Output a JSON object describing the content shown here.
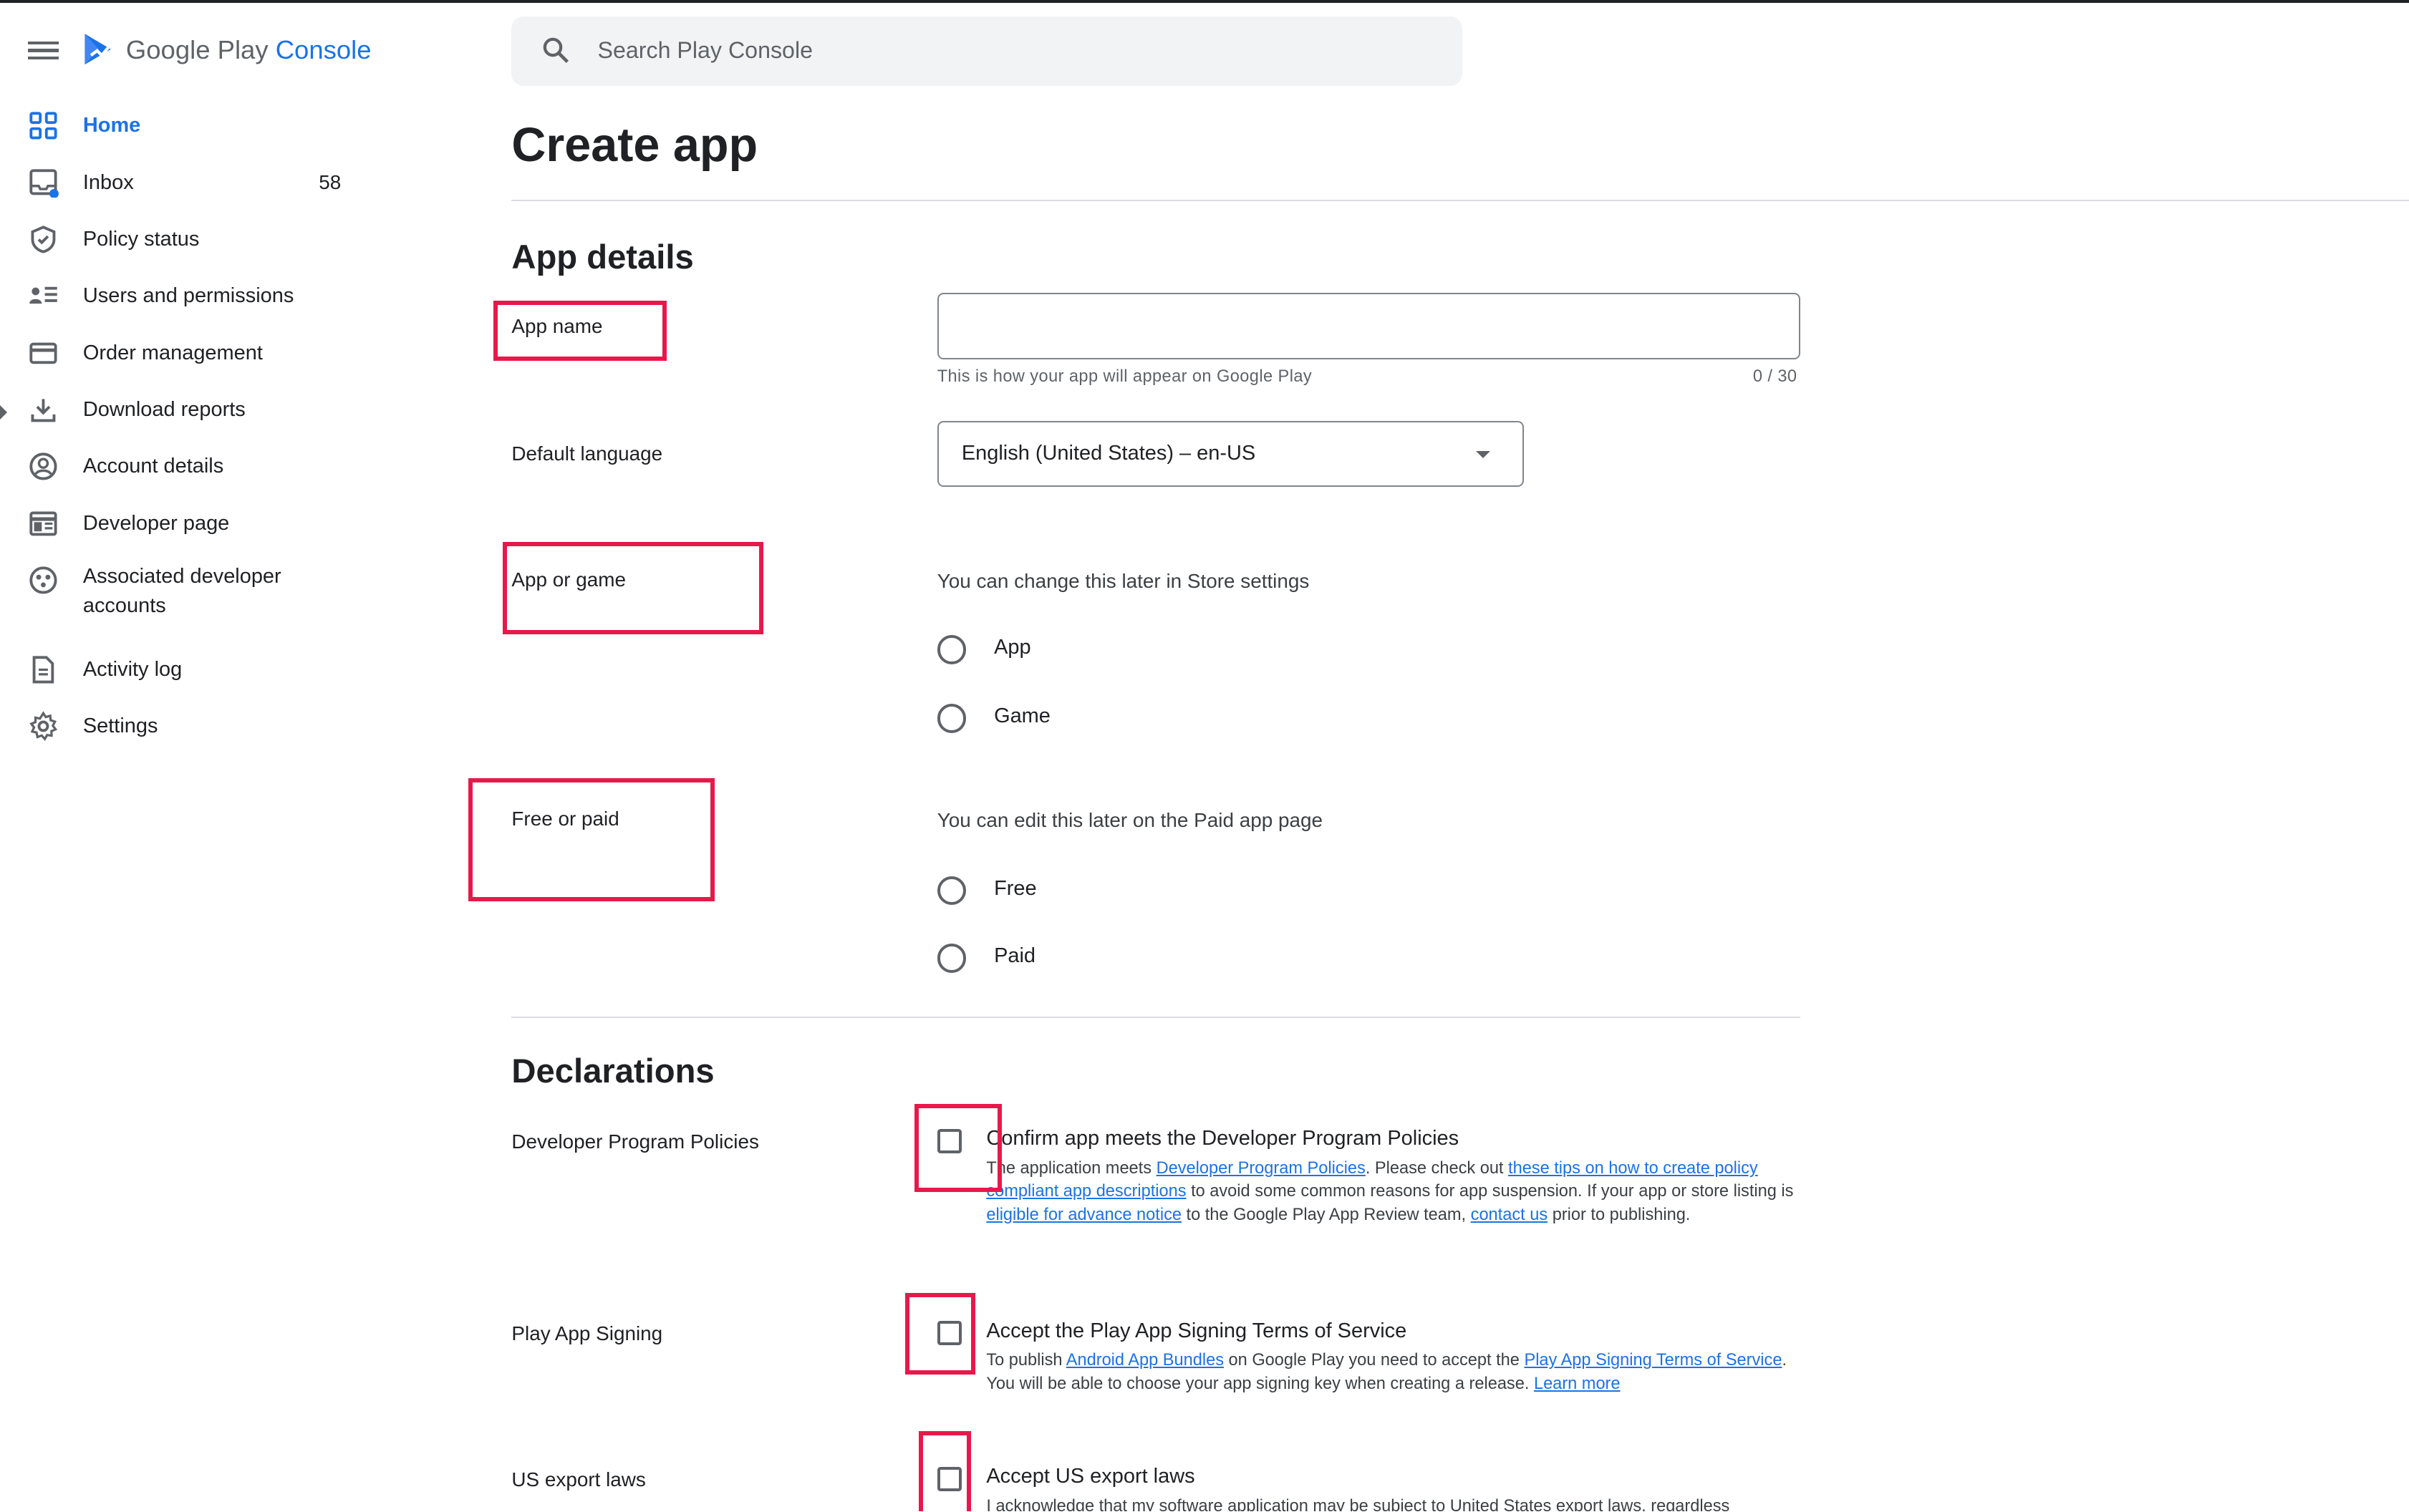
{
  "app": {
    "logo_text": "Google Play",
    "logo_accent": "Console"
  },
  "sidebar": {
    "items": [
      {
        "label": "Home",
        "icon": "home-grid-icon",
        "active": true
      },
      {
        "label": "Inbox",
        "icon": "inbox-icon",
        "count": "58"
      },
      {
        "label": "Policy status",
        "icon": "shield-icon"
      },
      {
        "label": "Users and permissions",
        "icon": "users-list-icon"
      },
      {
        "label": "Order management",
        "icon": "credit-card-icon"
      },
      {
        "label": "Download reports",
        "icon": "download-icon"
      },
      {
        "label": "Account details",
        "icon": "account-circle-icon"
      },
      {
        "label": "Developer page",
        "icon": "web-page-icon"
      },
      {
        "label": "Associated developer accounts",
        "icon": "linked-accounts-icon"
      },
      {
        "label": "Activity log",
        "icon": "document-icon"
      },
      {
        "label": "Settings",
        "icon": "gear-icon"
      }
    ]
  },
  "search": {
    "placeholder": "Search Play Console"
  },
  "page": {
    "title": "Create app"
  },
  "app_details": {
    "title": "App details",
    "app_name": {
      "label": "App name",
      "value": "",
      "helper": "This is how your app will appear on Google Play",
      "counter": "0 / 30"
    },
    "default_language": {
      "label": "Default language",
      "value": "English (United States) – en-US"
    },
    "app_or_game": {
      "label": "App or game",
      "hint": "You can change this later in Store settings",
      "options": [
        "App",
        "Game"
      ]
    },
    "free_or_paid": {
      "label": "Free or paid",
      "hint": "You can edit this later on the Paid app page",
      "options": [
        "Free",
        "Paid"
      ]
    }
  },
  "declarations": {
    "title": "Declarations",
    "policies": {
      "label": "Developer Program Policies",
      "checkbox_title": "Confirm app meets the Developer Program Policies",
      "body": {
        "t1": "The application meets ",
        "l1": "Developer Program Policies",
        "t2": ". Please check out ",
        "l2": "these tips on how to create policy compliant app descriptions",
        "t3": " to avoid some common reasons for app suspension. If your app or store listing is ",
        "l3": "eligible for advance notice",
        "t4": " to the Google Play App Review team, ",
        "l4": "contact us",
        "t5": " prior to publishing."
      }
    },
    "signing": {
      "label": "Play App Signing",
      "checkbox_title": "Accept the Play App Signing Terms of Service",
      "body": {
        "t1": "To publish ",
        "l1": "Android App Bundles",
        "t2": " on Google Play you need to accept the ",
        "l2": "Play App Signing Terms of Service",
        "t3": ". You will be able to choose your app signing key when creating a release. ",
        "l3": "Learn more"
      }
    },
    "export": {
      "label": "US export laws",
      "checkbox_title": "Accept US export laws",
      "body": "I acknowledge that my software application may be subject to United States export laws, regardless"
    }
  },
  "colors": {
    "accent": "#1a73e8",
    "highlight": "#e8184a"
  }
}
